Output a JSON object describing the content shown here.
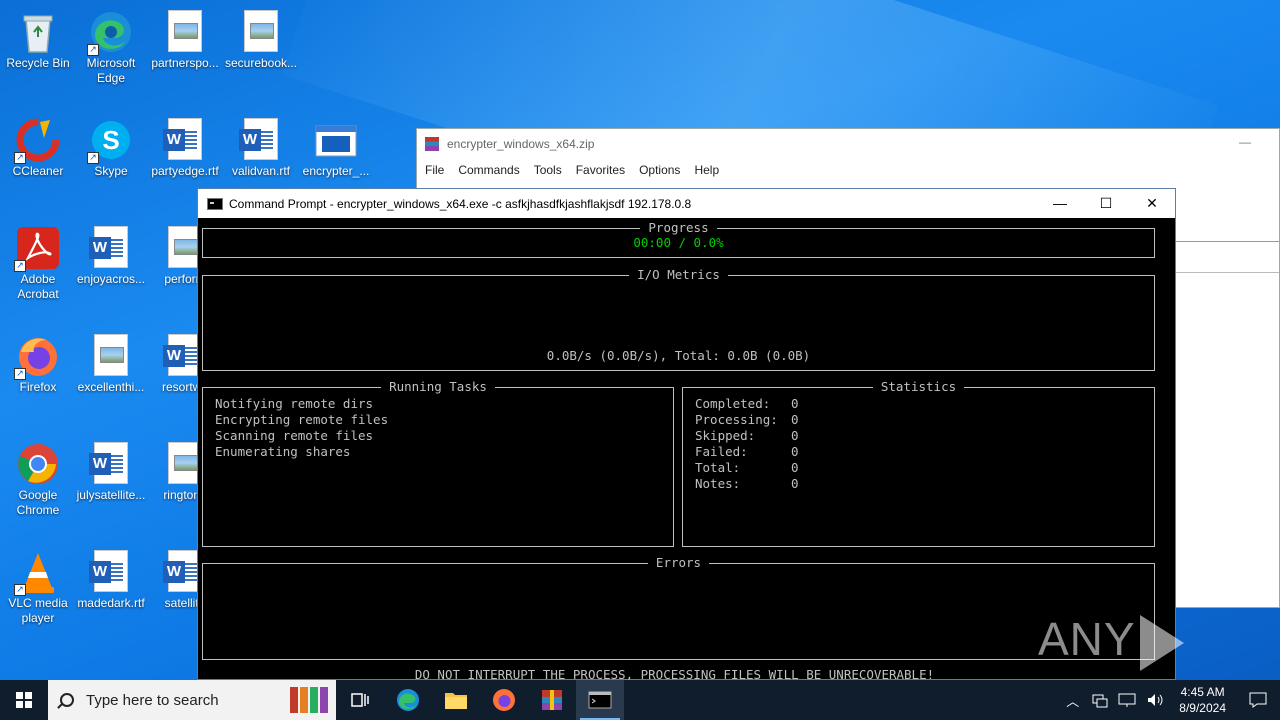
{
  "desktop_icons": [
    {
      "label": "Recycle Bin",
      "icon": "recycle-bin-icon"
    },
    {
      "label": "Microsoft Edge",
      "icon": "edge-icon"
    },
    {
      "label": "partnerspo...",
      "icon": "image-file-icon"
    },
    {
      "label": "securebook...",
      "icon": "image-file-icon"
    },
    {
      "label": "CCleaner",
      "icon": "ccleaner-icon"
    },
    {
      "label": "Skype",
      "icon": "skype-icon"
    },
    {
      "label": "partyedge.rtf",
      "icon": "word-file-icon"
    },
    {
      "label": "validvan.rtf",
      "icon": "word-file-icon"
    },
    {
      "label": "encrypter_...",
      "icon": "exe-file-icon"
    },
    {
      "label": "Adobe Acrobat",
      "icon": "acrobat-icon"
    },
    {
      "label": "enjoyacros...",
      "icon": "word-file-icon"
    },
    {
      "label": "perform",
      "icon": "image-file-icon"
    },
    {
      "label": "Firefox",
      "icon": "firefox-icon"
    },
    {
      "label": "excellenthi...",
      "icon": "image-file-icon"
    },
    {
      "label": "resortwe",
      "icon": "word-file-icon"
    },
    {
      "label": "Google Chrome",
      "icon": "chrome-icon"
    },
    {
      "label": "julysatellite...",
      "icon": "word-file-icon"
    },
    {
      "label": "ringtone",
      "icon": "image-file-icon"
    },
    {
      "label": "VLC media player",
      "icon": "vlc-icon"
    },
    {
      "label": "madedark.rtf",
      "icon": "word-file-icon"
    },
    {
      "label": "satellite",
      "icon": "word-file-icon"
    }
  ],
  "winrar": {
    "title": "encrypter_windows_x64.zip",
    "menu": [
      "File",
      "Commands",
      "Tools",
      "Favorites",
      "Options",
      "Help"
    ]
  },
  "cmd": {
    "title": "Command Prompt - encrypter_windows_x64.exe  -c asfkjhasdfkjashflakjsdf 192.178.0.8",
    "progress": {
      "title": "Progress",
      "value": "00:00 / 0.0%",
      "value_color": "#00d000"
    },
    "io": {
      "title": "I/O Metrics",
      "line": "0.0B/s (0.0B/s), Total: 0.0B (0.0B)"
    },
    "tasks": {
      "title": "Running Tasks",
      "items": [
        "Notifying remote dirs",
        "Encrypting remote files",
        "Scanning remote files",
        "Enumerating shares"
      ]
    },
    "stats": {
      "title": "Statistics",
      "rows": [
        {
          "label": "Completed:",
          "value": "0"
        },
        {
          "label": "Processing:",
          "value": "0"
        },
        {
          "label": "Skipped:",
          "value": "0"
        },
        {
          "label": "Failed:",
          "value": "0"
        },
        {
          "label": "Total:",
          "value": "0"
        },
        {
          "label": "Notes:",
          "value": "0"
        }
      ]
    },
    "errors": {
      "title": "Errors"
    },
    "footer": "DO NOT INTERRUPT THE PROCESS, PROCESSING FILES WILL BE UNRECOVERABLE!"
  },
  "watermark": {
    "left": "ANY",
    "right": "RUN"
  },
  "taskbar": {
    "search_placeholder": "Type here to search",
    "time": "4:45 AM",
    "date": "8/9/2024",
    "apps": [
      "task-view-icon",
      "edge-icon",
      "file-explorer-icon",
      "firefox-icon",
      "winrar-icon",
      "command-prompt-icon"
    ]
  }
}
